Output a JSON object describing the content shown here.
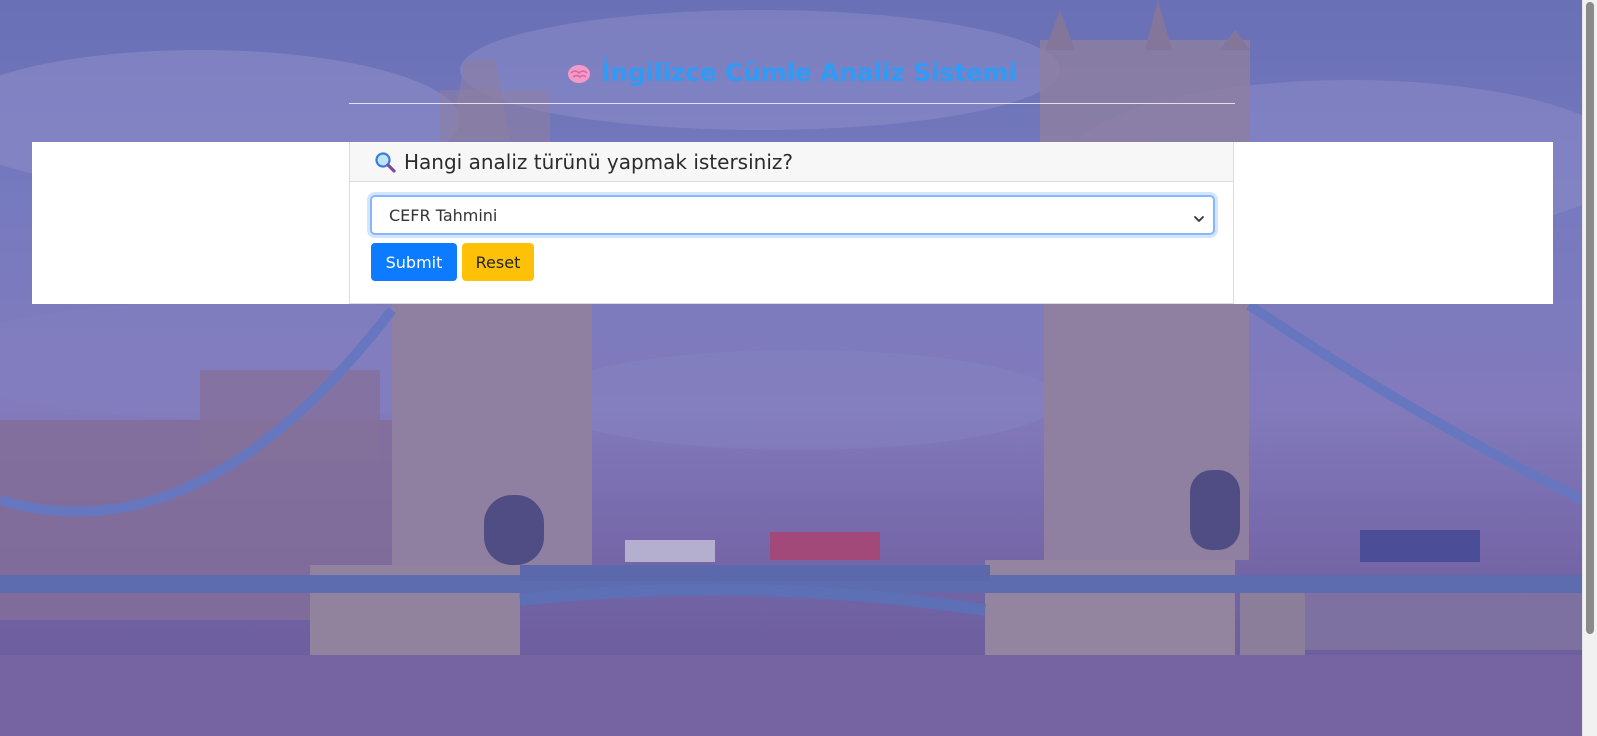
{
  "header": {
    "title": "İngilizce Cümle Analiz Sistemi",
    "title_icon": "brain-icon",
    "title_color": "#2f9bf5"
  },
  "analysis_card": {
    "question": "Hangi analiz türünü yapmak istersiniz?",
    "question_icon": "magnifier-icon",
    "select": {
      "selected_value": "CEFR Tahmini"
    },
    "buttons": {
      "submit_label": "Submit",
      "reset_label": "Reset"
    },
    "colors": {
      "submit": "#0d7bff",
      "reset": "#ffc107"
    }
  },
  "background": {
    "image_subject": "tower-bridge-photo"
  }
}
